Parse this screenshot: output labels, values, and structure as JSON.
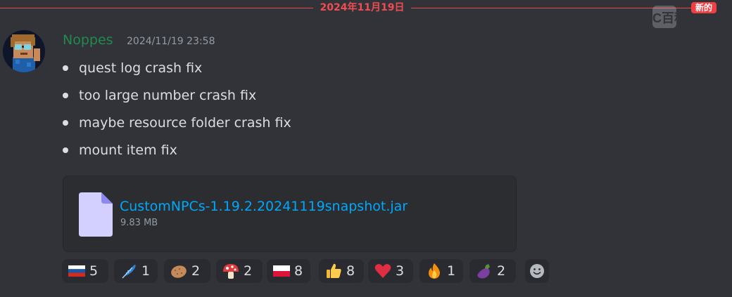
{
  "divider": {
    "date": "2024年11月19日",
    "new_badge": "新的"
  },
  "watermark": {
    "text": "MC百科"
  },
  "message": {
    "author": "Noppes",
    "timestamp": "2024/11/19 23:58",
    "author_color": "#1f8b4c",
    "bullets": [
      "quest log crash fix",
      "too large number crash fix",
      "maybe resource folder crash fix",
      "mount item fix"
    ]
  },
  "attachment": {
    "file_name": "CustomNPCs-1.19.2.20241119snapshot.jar",
    "file_size": "9.83 MB",
    "link_color": "#00a8fc"
  },
  "reactions": [
    {
      "icon": "russia-flag-icon",
      "count": "5"
    },
    {
      "icon": "blue-feather-icon",
      "count": "1"
    },
    {
      "icon": "potato-icon",
      "count": "2"
    },
    {
      "icon": "mushroom-icon",
      "count": "2"
    },
    {
      "icon": "poland-flag-icon",
      "count": "8"
    },
    {
      "icon": "thumbs-up-icon",
      "count": "8"
    },
    {
      "icon": "red-heart-icon",
      "count": "3"
    },
    {
      "icon": "fire-icon",
      "count": "1"
    },
    {
      "icon": "eggplant-icon",
      "count": "2"
    }
  ],
  "colors": {
    "background": "#323339",
    "divider": "#e5494c",
    "text": "#dbdee1",
    "muted": "#949ba4"
  }
}
